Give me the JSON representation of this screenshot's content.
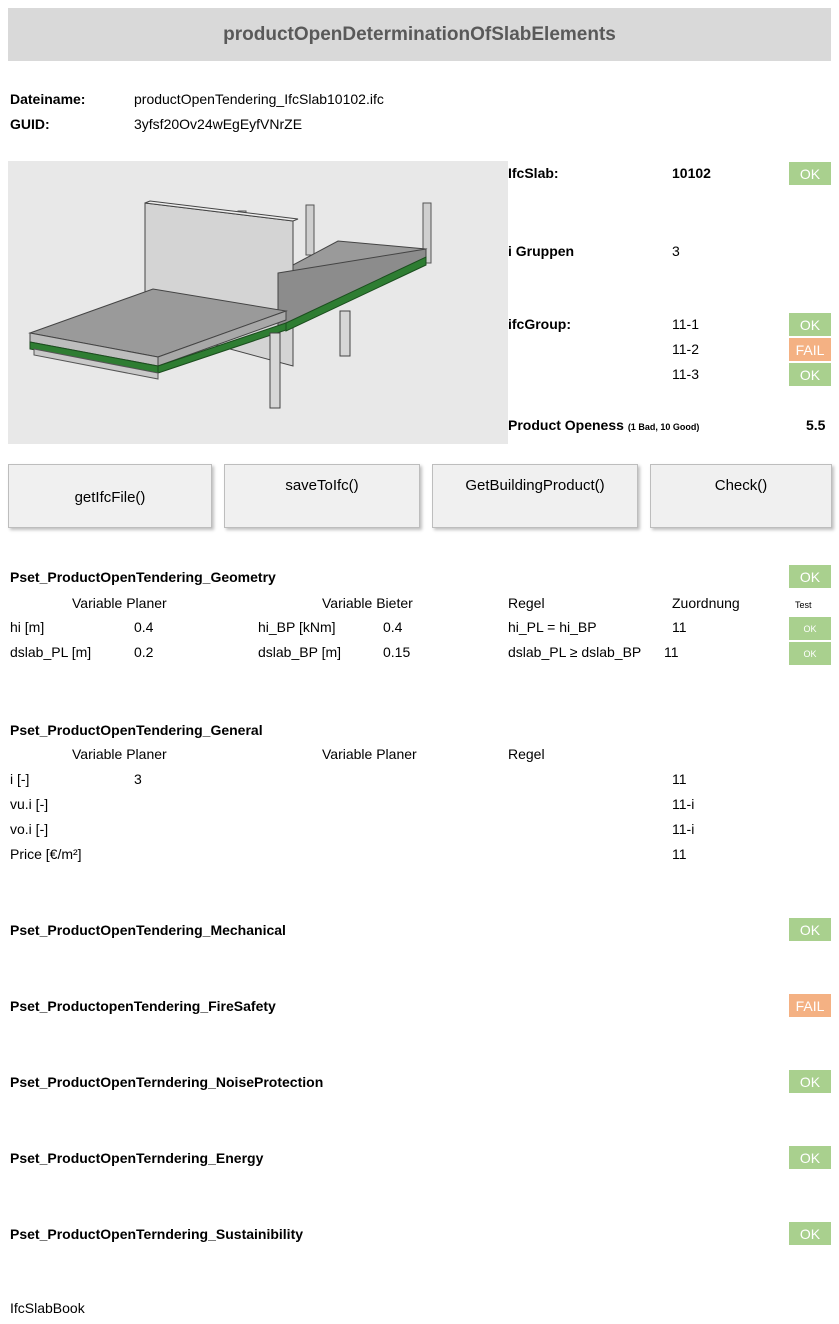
{
  "title": "productOpenDeterminationOfSlabElements",
  "file": {
    "name_label": "Dateiname:",
    "name_value": "productOpenTendering_IfcSlab10102.ifc",
    "guid_label": "GUID:",
    "guid_value": "3yfsf20Ov24wEgEyfVNrZE"
  },
  "summary": {
    "ifcslab_label": "IfcSlab:",
    "ifcslab_value": "10102",
    "ifcslab_status": "OK",
    "groups_label": "i Gruppen",
    "groups_value": "3",
    "ifcgroup_label": "ifcGroup:",
    "groups": [
      {
        "id": "11-1",
        "status": "OK"
      },
      {
        "id": "11-2",
        "status": "FAIL"
      },
      {
        "id": "11-3",
        "status": "OK"
      }
    ],
    "openness_label": "Product Openess",
    "openness_scale": "(1 Bad, 10 Good)",
    "openness_value": "5.5"
  },
  "buttons": {
    "get_file": "getIfcFile()",
    "save": "saveToIfc()",
    "get_product": "GetBuildingProduct()",
    "check": "Check()"
  },
  "geometry": {
    "title": "Pset_ProductOpenTendering_Geometry",
    "status": "OK",
    "headers": {
      "planer": "Variable Planer",
      "bieter": "Variable Bieter",
      "regel": "Regel",
      "zuordnung": "Zuordnung",
      "test": "Test"
    },
    "rows": [
      {
        "planer_var": "hi [m]",
        "planer_val": "0.4",
        "bieter_var": "hi_BP [kNm]",
        "bieter_val": "0.4",
        "regel": "hi_PL = hi_BP",
        "zuordnung": "11",
        "test": "OK"
      },
      {
        "planer_var": "dslab_PL [m]",
        "planer_val": "0.2",
        "bieter_var": "dslab_BP [m]",
        "bieter_val": "0.15",
        "regel": "dslab_PL ≥ dslab_BP",
        "zuordnung": "11",
        "test": "OK"
      }
    ]
  },
  "general": {
    "title": "Pset_ProductOpenTendering_General",
    "headers": {
      "planer": "Variable Planer",
      "planer2": "Variable Planer",
      "regel": "Regel"
    },
    "rows": [
      {
        "var": "i [-]",
        "val": "3",
        "zuordnung": "11"
      },
      {
        "var": "vu.i [-]",
        "val": "",
        "zuordnung": "11-i"
      },
      {
        "var": "vo.i [-]",
        "val": "",
        "zuordnung": "11-i"
      },
      {
        "var": "Price [€/m²]",
        "val": "",
        "zuordnung": "11"
      }
    ]
  },
  "psets": [
    {
      "title": "Pset_ProductOpenTendering_Mechanical",
      "status": "OK"
    },
    {
      "title": "Pset_ProductopenTendering_FireSafety",
      "status": "FAIL"
    },
    {
      "title": "Pset_ProductOpenTerndering_NoiseProtection",
      "status": "OK"
    },
    {
      "title": "Pset_ProductOpenTerndering_Energy",
      "status": "OK"
    },
    {
      "title": "Pset_ProductOpenTerndering_Sustainibility",
      "status": "OK"
    }
  ],
  "sheet_tab": "IfcSlabBook",
  "colors": {
    "ok": "#a9d08e",
    "fail": "#f4b183",
    "title_bg": "#d9d9d9",
    "slab_green": "#2e7d32"
  }
}
